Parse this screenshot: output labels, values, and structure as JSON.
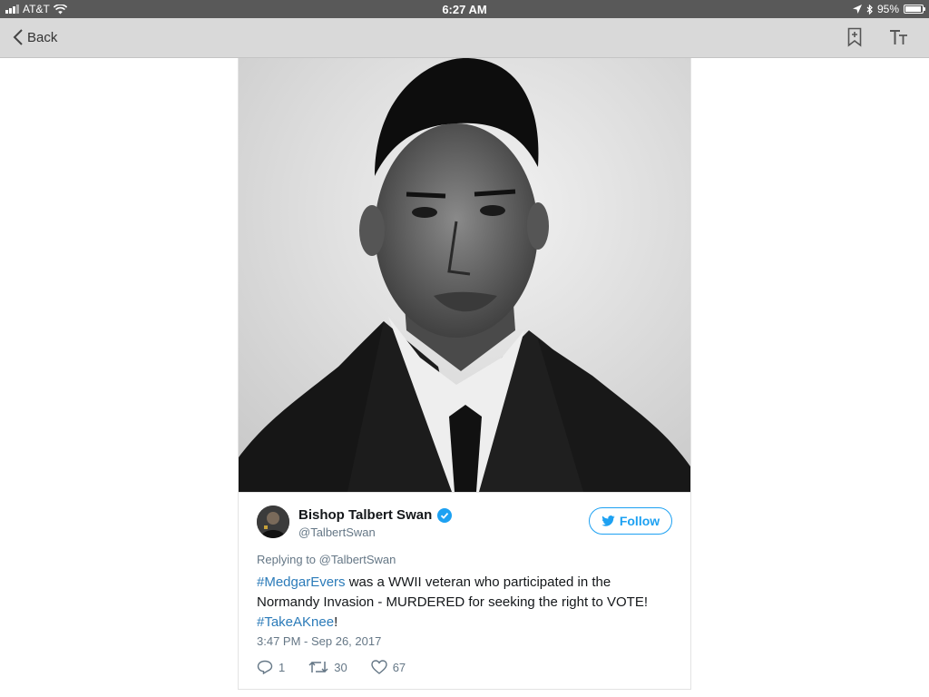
{
  "status_bar": {
    "carrier": "AT&T",
    "time": "6:27 AM",
    "battery": "95%",
    "battery_level": 0.95
  },
  "nav": {
    "back_label": "Back",
    "bookmark_icon": "bookmark-add-icon",
    "text_size_icon": "text-size-icon"
  },
  "photo": {
    "icon": "portrait-photo"
  },
  "tweet": {
    "author_name": "Bishop Talbert Swan",
    "verified_icon": "verified-badge-icon",
    "handle": "@TalbertSwan",
    "follow_label": "Follow",
    "replying_to": "Replying to @TalbertSwan",
    "text_part1_tag": "#MedgarEvers",
    "text_part2": " was a WWII veteran who participated in the Normandy Invasion - MURDERED for seeking the right to VOTE! ",
    "text_part3_tag": "#TakeAKnee",
    "text_part4": "!",
    "timestamp": "3:47 PM - Sep 26, 2017",
    "replies": "1",
    "retweets": "30",
    "likes": "67",
    "colors": {
      "link": "#2b7bb9",
      "follow": "#1da1f2",
      "verified": "#1da1f2"
    }
  }
}
